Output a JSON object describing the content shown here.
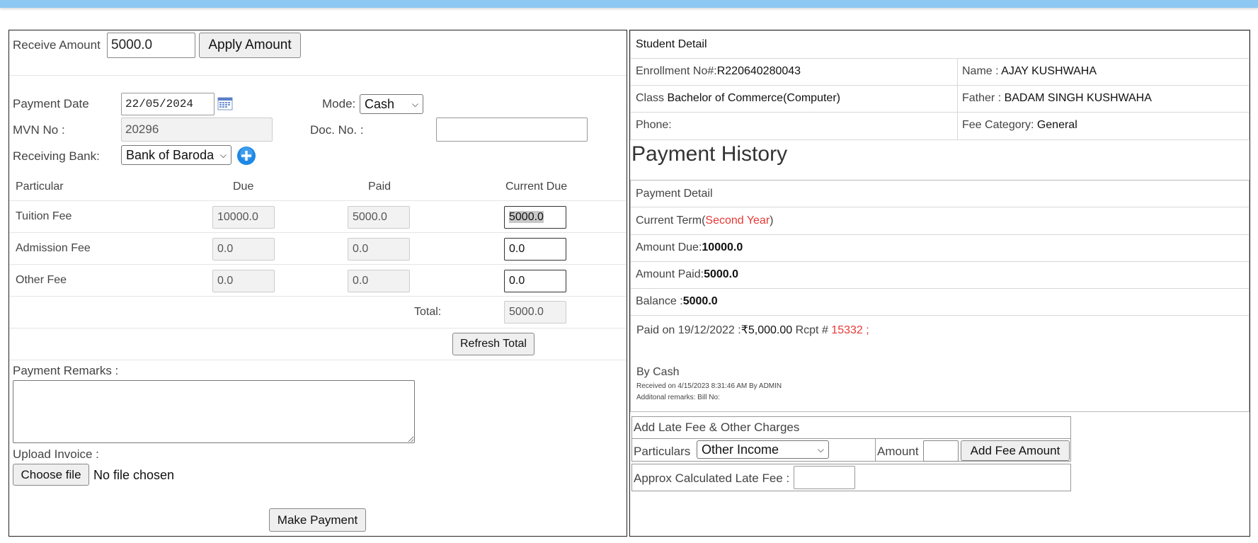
{
  "receive": {
    "label": "Receive Amount",
    "value": "5000.0",
    "apply_button": "Apply Amount"
  },
  "payment": {
    "date_label": "Payment Date",
    "date_value": "22/05/2024",
    "mode_label": "Mode:",
    "mode_value": "Cash",
    "mvn_label": "MVN No :",
    "mvn_value": "20296",
    "doc_label": "Doc. No. :",
    "doc_value": "",
    "bank_label": "Receiving Bank:",
    "bank_value": "Bank of Baroda"
  },
  "fee_table": {
    "headers": [
      "Particular",
      "Due",
      "Paid",
      "Current Due"
    ],
    "rows": [
      {
        "particular": "Tuition Fee",
        "due": "10000.0",
        "paid": "5000.0",
        "current_due": "5000.0"
      },
      {
        "particular": "Admission Fee",
        "due": "0.0",
        "paid": "0.0",
        "current_due": "0.0"
      },
      {
        "particular": "Other Fee",
        "due": "0.0",
        "paid": "0.0",
        "current_due": "0.0"
      }
    ],
    "total_label": "Total:",
    "total_value": "5000.0",
    "refresh_button": "Refresh Total"
  },
  "remarks": {
    "label": "Payment Remarks :",
    "value": ""
  },
  "upload": {
    "label": "Upload Invoice :",
    "choose_button": "Choose file",
    "status": "No file chosen"
  },
  "make_payment_button": "Make Payment",
  "student": {
    "heading": "Student Detail",
    "enrollment_label": "Enrollment No#:",
    "enrollment_value": "R220640280043",
    "name_label": "Name : ",
    "name_value": "AJAY KUSHWAHA",
    "class_label": "Class ",
    "class_value": "Bachelor of Commerce(Computer)",
    "father_label": "Father : ",
    "father_value": "BADAM SINGH KUSHWAHA",
    "phone_label": "Phone:",
    "phone_value": "",
    "category_label": "Fee Category: ",
    "category_value": "General"
  },
  "history": {
    "title": "Payment History",
    "detail_heading": "Payment Detail",
    "term_label": "Current Term(",
    "term_value": "Second Year",
    "term_close": ")",
    "due_label": "Amount Due:",
    "due_value": "10000.0",
    "paid_label": "Amount Paid:",
    "paid_value": "5000.0",
    "balance_label": "Balance :",
    "balance_value": "5000.0",
    "entry_paid_on": "Paid on 19/12/2022  :",
    "entry_amount": "₹5,000.00",
    "entry_rcpt_label": " Rcpt # ",
    "entry_rcpt_value": "15332 ;",
    "entry_mode": "By Cash",
    "entry_received": "Received on 4/15/2023 8:31:46 AM By ADMIN",
    "entry_remarks": "Additonal remarks: Bill No:"
  },
  "late_fee": {
    "heading": "Add Late Fee & Other Charges",
    "particulars_label": "Particulars",
    "particulars_value": "Other Income",
    "amount_label": "Amount",
    "amount_value": "",
    "add_button": "Add Fee Amount",
    "approx_label": "Approx Calculated Late Fee :",
    "approx_value": ""
  },
  "colors": {
    "topbar": "#8cc8f2",
    "accent_red": "#e53935",
    "add_icon": "#1e88e5"
  }
}
